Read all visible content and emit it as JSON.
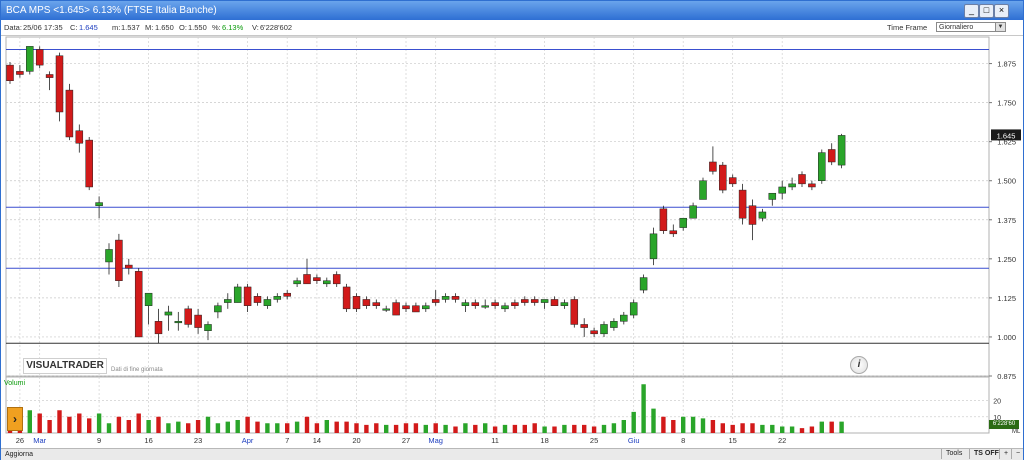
{
  "window": {
    "title": "BCA MPS <1.645> 6.13%  (FTSE Italia Banche)",
    "controls": [
      "_",
      "□",
      "×"
    ]
  },
  "info": {
    "data_label": "Data:",
    "date": "25/06 17:35",
    "c_label": "C:",
    "close": "1.645",
    "m_label": "m:",
    "min": "1.537",
    "M_label": "M:",
    "max": "1.650",
    "o_label": "O:",
    "open": "1.550",
    "pct_label": "%:",
    "pct": "6.13%",
    "v_label": "V:",
    "volume": "6'228'602",
    "timeframe_label": "Time Frame",
    "timeframe_value": "Giornaliero"
  },
  "branding": {
    "logo": "VISUALTRADER",
    "sub": "Dati di fine giornata",
    "info_icon": "i"
  },
  "volume_panel": {
    "label": "Volumi",
    "ticks": [
      "20",
      "10"
    ],
    "current_value": "6'228'60",
    "ml_label": "ML"
  },
  "bottombar": {
    "aggiorna": "Aggiorna",
    "tools": "Tools",
    "ts_off": "TS OFF"
  },
  "chart_data": {
    "type": "candlestick",
    "y_ticks": [
      "1.875",
      "1.750",
      "1.625",
      "1.500",
      "1.375",
      "1.250",
      "1.125",
      "1.000",
      "0.875"
    ],
    "ylim": [
      0.875,
      1.96
    ],
    "price_tag": "1.645",
    "hlines": [
      1.92,
      1.415,
      1.22,
      0.98
    ],
    "x_labels": [
      {
        "label": "26",
        "index": 1,
        "month": false
      },
      {
        "label": "Mar",
        "index": 3,
        "month": true
      },
      {
        "label": "9",
        "index": 9,
        "month": false
      },
      {
        "label": "16",
        "index": 14,
        "month": false
      },
      {
        "label": "23",
        "index": 19,
        "month": false
      },
      {
        "label": "Apr",
        "index": 24,
        "month": true
      },
      {
        "label": "7",
        "index": 28,
        "month": false
      },
      {
        "label": "14",
        "index": 31,
        "month": false
      },
      {
        "label": "20",
        "index": 35,
        "month": false
      },
      {
        "label": "27",
        "index": 40,
        "month": false
      },
      {
        "label": "Mag",
        "index": 43,
        "month": true
      },
      {
        "label": "11",
        "index": 49,
        "month": false
      },
      {
        "label": "18",
        "index": 54,
        "month": false
      },
      {
        "label": "25",
        "index": 59,
        "month": false
      },
      {
        "label": "Giu",
        "index": 63,
        "month": true
      },
      {
        "label": "8",
        "index": 68,
        "month": false
      },
      {
        "label": "15",
        "index": 73,
        "month": false
      },
      {
        "label": "22",
        "index": 78,
        "month": false
      }
    ],
    "candles": [
      {
        "o": 1.87,
        "h": 1.88,
        "l": 1.81,
        "c": 1.82
      },
      {
        "o": 1.85,
        "h": 1.87,
        "l": 1.83,
        "c": 1.84
      },
      {
        "o": 1.85,
        "h": 1.93,
        "l": 1.84,
        "c": 1.93
      },
      {
        "o": 1.92,
        "h": 1.93,
        "l": 1.86,
        "c": 1.87
      },
      {
        "o": 1.84,
        "h": 1.85,
        "l": 1.79,
        "c": 1.83
      },
      {
        "o": 1.9,
        "h": 1.91,
        "l": 1.69,
        "c": 1.72
      },
      {
        "o": 1.79,
        "h": 1.81,
        "l": 1.63,
        "c": 1.64
      },
      {
        "o": 1.66,
        "h": 1.68,
        "l": 1.59,
        "c": 1.62
      },
      {
        "o": 1.63,
        "h": 1.64,
        "l": 1.47,
        "c": 1.48
      },
      {
        "o": 1.42,
        "h": 1.45,
        "l": 1.38,
        "c": 1.43
      },
      {
        "o": 1.24,
        "h": 1.3,
        "l": 1.2,
        "c": 1.28
      },
      {
        "o": 1.31,
        "h": 1.33,
        "l": 1.16,
        "c": 1.18
      },
      {
        "o": 1.23,
        "h": 1.25,
        "l": 1.2,
        "c": 1.22
      },
      {
        "o": 1.21,
        "h": 1.22,
        "l": 1.0,
        "c": 1.0
      },
      {
        "o": 1.1,
        "h": 1.14,
        "l": 1.04,
        "c": 1.14
      },
      {
        "o": 1.05,
        "h": 1.09,
        "l": 0.98,
        "c": 1.01
      },
      {
        "o": 1.07,
        "h": 1.1,
        "l": 1.02,
        "c": 1.08
      },
      {
        "o": 1.05,
        "h": 1.08,
        "l": 1.02,
        "c": 1.05
      },
      {
        "o": 1.09,
        "h": 1.1,
        "l": 1.03,
        "c": 1.04
      },
      {
        "o": 1.07,
        "h": 1.09,
        "l": 1.01,
        "c": 1.03
      },
      {
        "o": 1.02,
        "h": 1.05,
        "l": 0.99,
        "c": 1.04
      },
      {
        "o": 1.08,
        "h": 1.11,
        "l": 1.06,
        "c": 1.1
      },
      {
        "o": 1.11,
        "h": 1.14,
        "l": 1.09,
        "c": 1.12
      },
      {
        "o": 1.11,
        "h": 1.17,
        "l": 1.11,
        "c": 1.16
      },
      {
        "o": 1.16,
        "h": 1.17,
        "l": 1.08,
        "c": 1.1
      },
      {
        "o": 1.13,
        "h": 1.14,
        "l": 1.1,
        "c": 1.11
      },
      {
        "o": 1.1,
        "h": 1.13,
        "l": 1.09,
        "c": 1.12
      },
      {
        "o": 1.12,
        "h": 1.14,
        "l": 1.11,
        "c": 1.13
      },
      {
        "o": 1.14,
        "h": 1.15,
        "l": 1.12,
        "c": 1.13
      },
      {
        "o": 1.17,
        "h": 1.19,
        "l": 1.16,
        "c": 1.18
      },
      {
        "o": 1.2,
        "h": 1.25,
        "l": 1.17,
        "c": 1.17
      },
      {
        "o": 1.19,
        "h": 1.2,
        "l": 1.17,
        "c": 1.18
      },
      {
        "o": 1.17,
        "h": 1.19,
        "l": 1.16,
        "c": 1.18
      },
      {
        "o": 1.2,
        "h": 1.21,
        "l": 1.16,
        "c": 1.17
      },
      {
        "o": 1.16,
        "h": 1.17,
        "l": 1.08,
        "c": 1.09
      },
      {
        "o": 1.13,
        "h": 1.14,
        "l": 1.08,
        "c": 1.09
      },
      {
        "o": 1.12,
        "h": 1.13,
        "l": 1.09,
        "c": 1.1
      },
      {
        "o": 1.11,
        "h": 1.12,
        "l": 1.09,
        "c": 1.1
      },
      {
        "o": 1.09,
        "h": 1.1,
        "l": 1.08,
        "c": 1.09
      },
      {
        "o": 1.11,
        "h": 1.12,
        "l": 1.07,
        "c": 1.07
      },
      {
        "o": 1.1,
        "h": 1.11,
        "l": 1.08,
        "c": 1.09
      },
      {
        "o": 1.1,
        "h": 1.11,
        "l": 1.08,
        "c": 1.08
      },
      {
        "o": 1.09,
        "h": 1.11,
        "l": 1.08,
        "c": 1.1
      },
      {
        "o": 1.12,
        "h": 1.15,
        "l": 1.1,
        "c": 1.11
      },
      {
        "o": 1.12,
        "h": 1.14,
        "l": 1.11,
        "c": 1.13
      },
      {
        "o": 1.13,
        "h": 1.14,
        "l": 1.11,
        "c": 1.12
      },
      {
        "o": 1.1,
        "h": 1.12,
        "l": 1.08,
        "c": 1.11
      },
      {
        "o": 1.11,
        "h": 1.12,
        "l": 1.09,
        "c": 1.1
      },
      {
        "o": 1.1,
        "h": 1.12,
        "l": 1.09,
        "c": 1.1
      },
      {
        "o": 1.11,
        "h": 1.12,
        "l": 1.09,
        "c": 1.1
      },
      {
        "o": 1.09,
        "h": 1.11,
        "l": 1.08,
        "c": 1.1
      },
      {
        "o": 1.11,
        "h": 1.12,
        "l": 1.09,
        "c": 1.1
      },
      {
        "o": 1.12,
        "h": 1.13,
        "l": 1.1,
        "c": 1.11
      },
      {
        "o": 1.12,
        "h": 1.13,
        "l": 1.1,
        "c": 1.11
      },
      {
        "o": 1.11,
        "h": 1.12,
        "l": 1.09,
        "c": 1.12
      },
      {
        "o": 1.12,
        "h": 1.13,
        "l": 1.1,
        "c": 1.1
      },
      {
        "o": 1.1,
        "h": 1.12,
        "l": 1.09,
        "c": 1.11
      },
      {
        "o": 1.12,
        "h": 1.13,
        "l": 1.03,
        "c": 1.04
      },
      {
        "o": 1.04,
        "h": 1.06,
        "l": 1.0,
        "c": 1.03
      },
      {
        "o": 1.02,
        "h": 1.03,
        "l": 1.0,
        "c": 1.01
      },
      {
        "o": 1.01,
        "h": 1.05,
        "l": 1.0,
        "c": 1.04
      },
      {
        "o": 1.03,
        "h": 1.06,
        "l": 1.02,
        "c": 1.05
      },
      {
        "o": 1.05,
        "h": 1.08,
        "l": 1.04,
        "c": 1.07
      },
      {
        "o": 1.07,
        "h": 1.12,
        "l": 1.06,
        "c": 1.11
      },
      {
        "o": 1.15,
        "h": 1.2,
        "l": 1.14,
        "c": 1.19
      },
      {
        "o": 1.25,
        "h": 1.35,
        "l": 1.23,
        "c": 1.33
      },
      {
        "o": 1.41,
        "h": 1.42,
        "l": 1.33,
        "c": 1.34
      },
      {
        "o": 1.34,
        "h": 1.36,
        "l": 1.32,
        "c": 1.33
      },
      {
        "o": 1.35,
        "h": 1.38,
        "l": 1.34,
        "c": 1.38
      },
      {
        "o": 1.38,
        "h": 1.43,
        "l": 1.38,
        "c": 1.42
      },
      {
        "o": 1.44,
        "h": 1.51,
        "l": 1.44,
        "c": 1.5
      },
      {
        "o": 1.56,
        "h": 1.61,
        "l": 1.52,
        "c": 1.53
      },
      {
        "o": 1.55,
        "h": 1.56,
        "l": 1.46,
        "c": 1.47
      },
      {
        "o": 1.51,
        "h": 1.52,
        "l": 1.48,
        "c": 1.49
      },
      {
        "o": 1.47,
        "h": 1.49,
        "l": 1.36,
        "c": 1.38
      },
      {
        "o": 1.42,
        "h": 1.44,
        "l": 1.31,
        "c": 1.36
      },
      {
        "o": 1.38,
        "h": 1.41,
        "l": 1.37,
        "c": 1.4
      },
      {
        "o": 1.44,
        "h": 1.46,
        "l": 1.42,
        "c": 1.46
      },
      {
        "o": 1.46,
        "h": 1.5,
        "l": 1.44,
        "c": 1.48
      },
      {
        "o": 1.48,
        "h": 1.51,
        "l": 1.47,
        "c": 1.49
      },
      {
        "o": 1.52,
        "h": 1.53,
        "l": 1.48,
        "c": 1.49
      },
      {
        "o": 1.49,
        "h": 1.5,
        "l": 1.47,
        "c": 1.48
      },
      {
        "o": 1.5,
        "h": 1.6,
        "l": 1.49,
        "c": 1.59
      },
      {
        "o": 1.6,
        "h": 1.62,
        "l": 1.55,
        "c": 1.56
      },
      {
        "o": 1.55,
        "h": 1.65,
        "l": 1.54,
        "c": 1.645
      }
    ],
    "volume": [
      10,
      10,
      14,
      12,
      8,
      14,
      10,
      12,
      9,
      12,
      6,
      10,
      8,
      12,
      8,
      10,
      6,
      7,
      6,
      8,
      10,
      6,
      7,
      8,
      10,
      7,
      6,
      6,
      6,
      7,
      10,
      6,
      8,
      7,
      7,
      6,
      5,
      6,
      5,
      5,
      6,
      6,
      5,
      6,
      5,
      4,
      6,
      5,
      6,
      4,
      5,
      5,
      5,
      6,
      4,
      4,
      5,
      5,
      5,
      4,
      5,
      6,
      8,
      13,
      30,
      15,
      10,
      8,
      10,
      10,
      9,
      8,
      6,
      5,
      6,
      6,
      5,
      5,
      4,
      4,
      3,
      4,
      7,
      7,
      7
    ]
  }
}
